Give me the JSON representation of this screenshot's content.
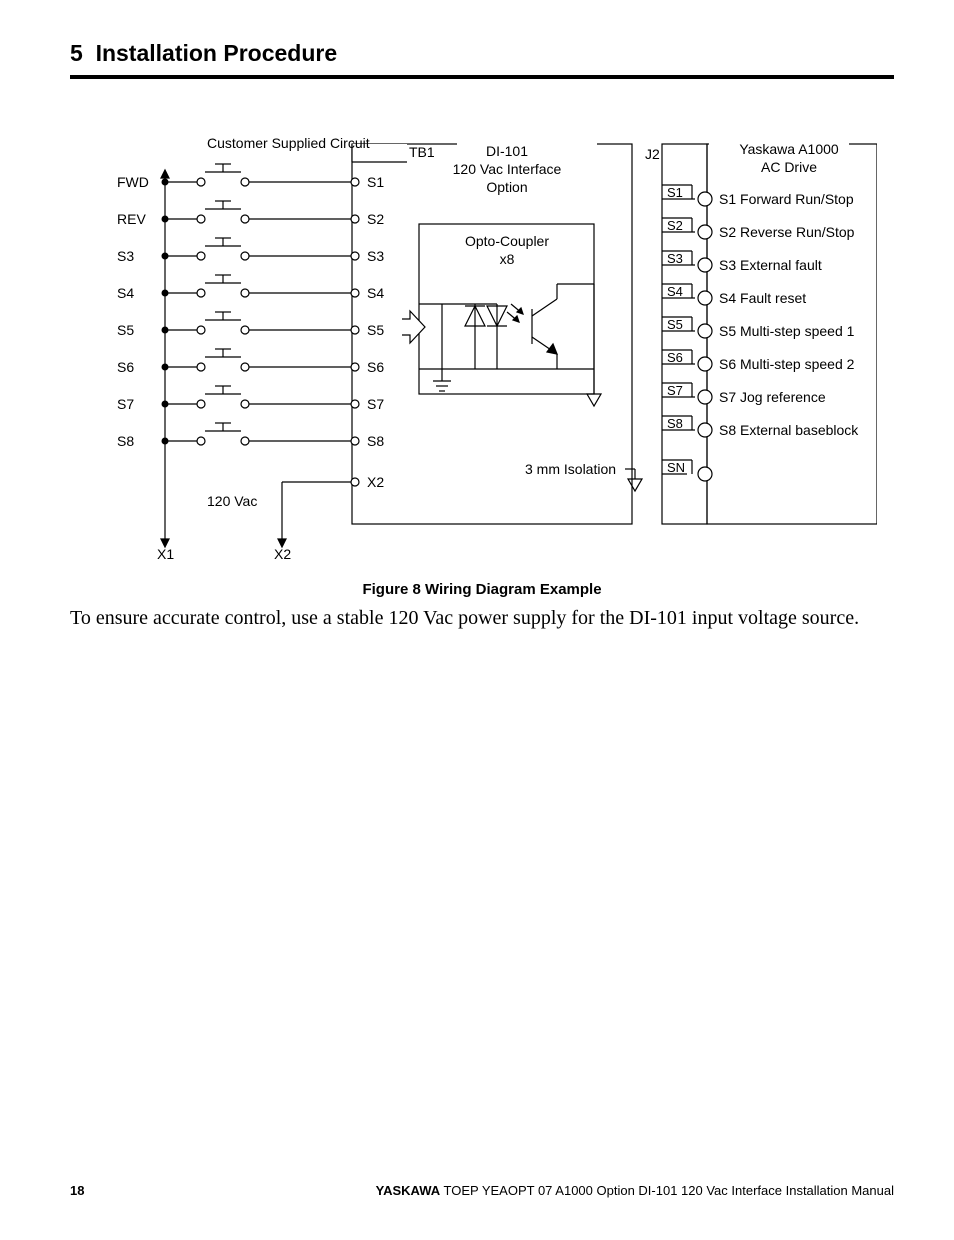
{
  "section": {
    "number": "5",
    "title": "Installation Procedure"
  },
  "figure": {
    "caption": "Figure 8  Wiring Diagram Example",
    "body_text": "To ensure accurate control, use a stable 120 Vac power supply for the DI-101 input voltage source.",
    "labels": {
      "customer_circuit": "Customer Supplied Circuit",
      "tb1": "TB1",
      "di101_line1": "DI-101",
      "di101_line2": "120 Vac Interface",
      "di101_line3": "Option",
      "opto_line1": "Opto-Coupler",
      "opto_line2": "x8",
      "j2": "J2",
      "drive_line1": "Yaskawa A1000",
      "drive_line2": "AC Drive",
      "isolation": "3 mm Isolation",
      "voltage": "120 Vac",
      "x1": "X1",
      "x2": "X2"
    },
    "left_inputs": [
      {
        "code": "FWD",
        "pin": "S1"
      },
      {
        "code": "REV",
        "pin": "S2"
      },
      {
        "code": "S3",
        "pin": "S3"
      },
      {
        "code": "S4",
        "pin": "S4"
      },
      {
        "code": "S5",
        "pin": "S5"
      },
      {
        "code": "S6",
        "pin": "S6"
      },
      {
        "code": "S7",
        "pin": "S7"
      },
      {
        "code": "S8",
        "pin": "S8"
      }
    ],
    "x2_pin": "X2",
    "right_terminals": [
      {
        "pin": "S1",
        "desc": "S1 Forward Run/Stop"
      },
      {
        "pin": "S2",
        "desc": "S2 Reverse Run/Stop"
      },
      {
        "pin": "S3",
        "desc": "S3 External fault"
      },
      {
        "pin": "S4",
        "desc": "S4 Fault reset"
      },
      {
        "pin": "S5",
        "desc": "S5 Multi-step speed 1"
      },
      {
        "pin": "S6",
        "desc": "S6 Multi-step speed 2"
      },
      {
        "pin": "S7",
        "desc": "S7 Jog reference"
      },
      {
        "pin": "S8",
        "desc": "S8 External baseblock"
      }
    ],
    "sn_pin": "SN"
  },
  "footer": {
    "page_number": "18",
    "brand": "YASKAWA",
    "doc_title": " TOEP YEAOPT 07 A1000 Option DI-101 120 Vac Interface Installation Manual"
  }
}
